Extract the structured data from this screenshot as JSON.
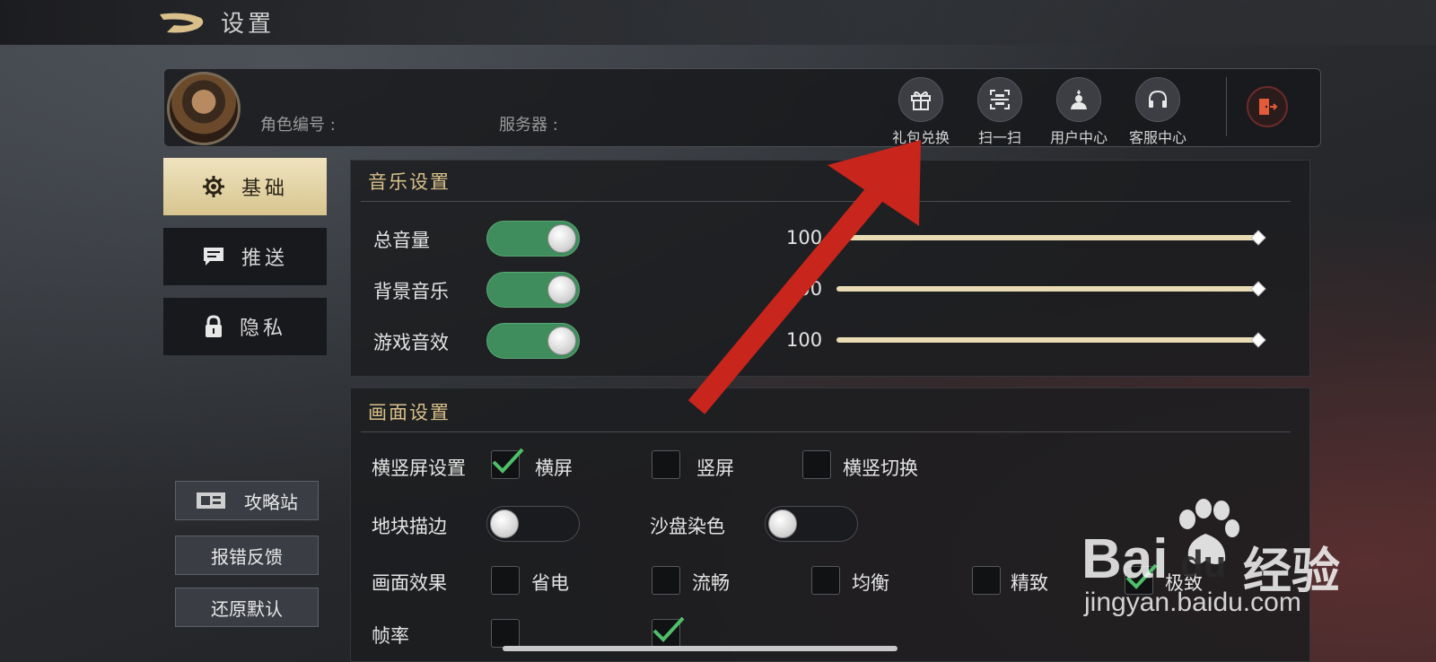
{
  "header": {
    "title": "设置"
  },
  "profile": {
    "role_label": "角色编号 :",
    "server_label": "服务器 :",
    "tools": [
      {
        "label": "礼包兑换",
        "icon": "gift-icon"
      },
      {
        "label": "扫一扫",
        "icon": "scan-icon"
      },
      {
        "label": "用户中心",
        "icon": "user-icon"
      },
      {
        "label": "客服中心",
        "icon": "headset-icon"
      }
    ],
    "exit_icon": "exit-icon"
  },
  "nav": {
    "items": [
      {
        "label": "基础",
        "icon": "gear-icon",
        "active": true
      },
      {
        "label": "推送",
        "icon": "message-icon",
        "active": false
      },
      {
        "label": "隐私",
        "icon": "lock-icon",
        "active": false
      }
    ],
    "guide_label": "攻略站",
    "feedback_label": "报错反馈",
    "reset_label": "还原默认"
  },
  "audio": {
    "title": "音乐设置",
    "rows": [
      {
        "label": "总音量",
        "on": true,
        "value": "100"
      },
      {
        "label": "背景音乐",
        "on": true,
        "value": "100"
      },
      {
        "label": "游戏音效",
        "on": true,
        "value": "100"
      }
    ]
  },
  "display": {
    "title": "画面设置",
    "orientation": {
      "label": "横竖屏设置",
      "options": [
        {
          "label": "横屏",
          "checked": true
        },
        {
          "label": "竖屏",
          "checked": false
        },
        {
          "label": "横竖切换",
          "checked": false
        }
      ]
    },
    "tile_outline": {
      "label": "地块描边",
      "on": false
    },
    "sand_color": {
      "label": "沙盘染色",
      "on": false
    },
    "effect": {
      "label": "画面效果",
      "options": [
        {
          "label": "省电",
          "checked": false
        },
        {
          "label": "流畅",
          "checked": false
        },
        {
          "label": "均衡",
          "checked": false
        },
        {
          "label": "精致",
          "checked": false
        },
        {
          "label": "极致",
          "checked": true
        }
      ]
    },
    "frame_rate": {
      "label": "帧率"
    }
  },
  "watermark": {
    "brand_left": "Bai",
    "brand_right": "du",
    "suffix": "经验",
    "url": "jingyan.baidu.com"
  },
  "colors": {
    "accent_gold": "#d9c08a",
    "toggle_on": "#3f8d5c",
    "arrow_red": "#c8251c"
  }
}
